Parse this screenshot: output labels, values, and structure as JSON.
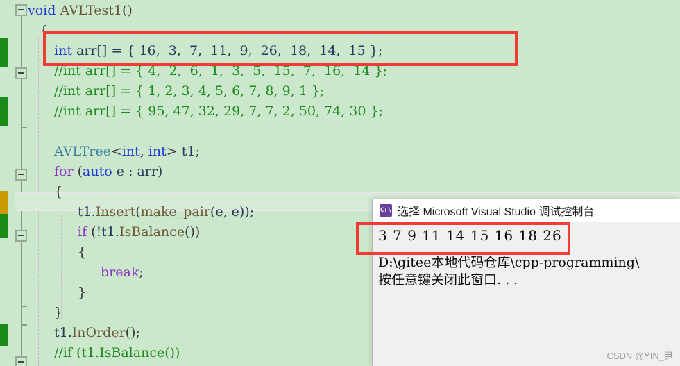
{
  "editor": {
    "background_color": "#cce8cc",
    "current_line_color": "#d7ecd7",
    "lines": [
      {
        "indent": 0,
        "text": "void AVLTest1()"
      },
      {
        "indent": 1,
        "text": "{"
      },
      {
        "indent": 2,
        "text": "int arr[] = { 16,  3,  7,  11,  9,  26,  18,  14,  15 };"
      },
      {
        "indent": 2,
        "text": "//int arr[] = { 4,  2,  6,  1,  3,  5,  15,  7,  16,  14 };"
      },
      {
        "indent": 2,
        "text": "//int arr[] = { 1, 2, 3, 4, 5, 6, 7, 8, 9, 1 };"
      },
      {
        "indent": 2,
        "text": "//int arr[] = { 95, 47, 32, 29, 7, 7, 2, 50, 74, 30 };"
      },
      {
        "indent": 0,
        "text": ""
      },
      {
        "indent": 2,
        "text": "AVLTree<int, int> t1;"
      },
      {
        "indent": 2,
        "text": "for (auto e : arr)"
      },
      {
        "indent": 2,
        "text": "{"
      },
      {
        "indent": 3,
        "text": "t1.Insert(make_pair(e, e));"
      },
      {
        "indent": 3,
        "text": "if (!t1.IsBalance())"
      },
      {
        "indent": 3,
        "text": "{"
      },
      {
        "indent": 4,
        "text": "break;"
      },
      {
        "indent": 3,
        "text": "}"
      },
      {
        "indent": 2,
        "text": "}"
      },
      {
        "indent": 2,
        "text": "t1.InOrder();"
      },
      {
        "indent": 2,
        "text": "//if (t1.IsBalance())"
      }
    ]
  },
  "annotations": {
    "rect_color": "#f23b34",
    "code_rect_label": "highlight-array-declaration",
    "console_rect_label": "highlight-sorted-output"
  },
  "console": {
    "title": "选择 Microsoft Visual Studio 调试控制台",
    "icon": "console-cmd-icon",
    "icon_text": "C:\\",
    "output": "3 7 9 11 14 15 16 18 26",
    "path_line": "D:\\gitee本地代码仓库\\cpp-programming\\",
    "prompt_line": "按任意键关闭此窗口. . .",
    "background_color": "#f0f0f0",
    "titlebar_color": "#ffffff"
  },
  "watermark": {
    "text": "CSDN @YIN_尹"
  }
}
